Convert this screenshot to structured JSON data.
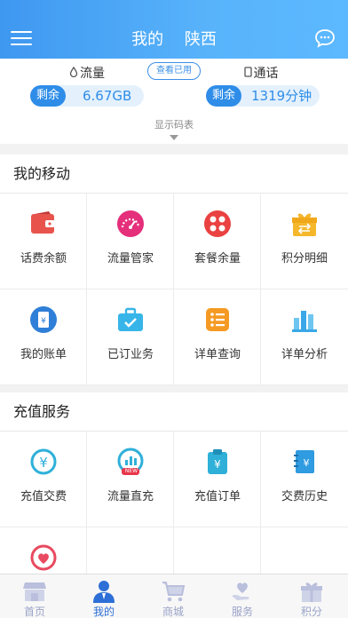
{
  "header": {
    "title": "我的",
    "region": "陕西"
  },
  "balance": {
    "data": {
      "label": "流量",
      "remain_tag": "剩余",
      "value": "6.67GB"
    },
    "voice": {
      "label": "通话",
      "remain_tag": "剩余",
      "value": "1319分钟"
    },
    "view_used_button": "查看已用",
    "code_table_label": "显示码表"
  },
  "my_mobile": {
    "title": "我的移动",
    "items": [
      {
        "label": "话费余额",
        "icon": "wallet-icon"
      },
      {
        "label": "流量管家",
        "icon": "speedometer-icon"
      },
      {
        "label": "套餐余量",
        "icon": "package-grid-icon"
      },
      {
        "label": "积分明细",
        "icon": "gift-icon"
      },
      {
        "label": "我的账单",
        "icon": "bill-icon"
      },
      {
        "label": "已订业务",
        "icon": "briefcase-check-icon"
      },
      {
        "label": "详单查询",
        "icon": "list-icon"
      },
      {
        "label": "详单分析",
        "icon": "bar-chart-icon"
      }
    ]
  },
  "recharge": {
    "title": "充值服务",
    "items": [
      {
        "label": "充值交费",
        "icon": "yuan-coin-icon"
      },
      {
        "label": "流量直充",
        "icon": "data-recharge-icon",
        "badge": "NEW"
      },
      {
        "label": "充值订单",
        "icon": "order-clipboard-icon"
      },
      {
        "label": "交费历史",
        "icon": "history-notebook-icon"
      },
      {
        "label": "",
        "icon": "heart-icon"
      }
    ]
  },
  "tabbar": {
    "tabs": [
      {
        "label": "首页",
        "active": false
      },
      {
        "label": "我的",
        "active": true
      },
      {
        "label": "商城",
        "active": false
      },
      {
        "label": "服务",
        "active": false
      },
      {
        "label": "积分",
        "active": false
      }
    ]
  },
  "colors": {
    "header_start": "#3f98f0",
    "header_end": "#5cb8ff",
    "accent_blue": "#2f8de8",
    "tab_active": "#2d6fd6"
  }
}
